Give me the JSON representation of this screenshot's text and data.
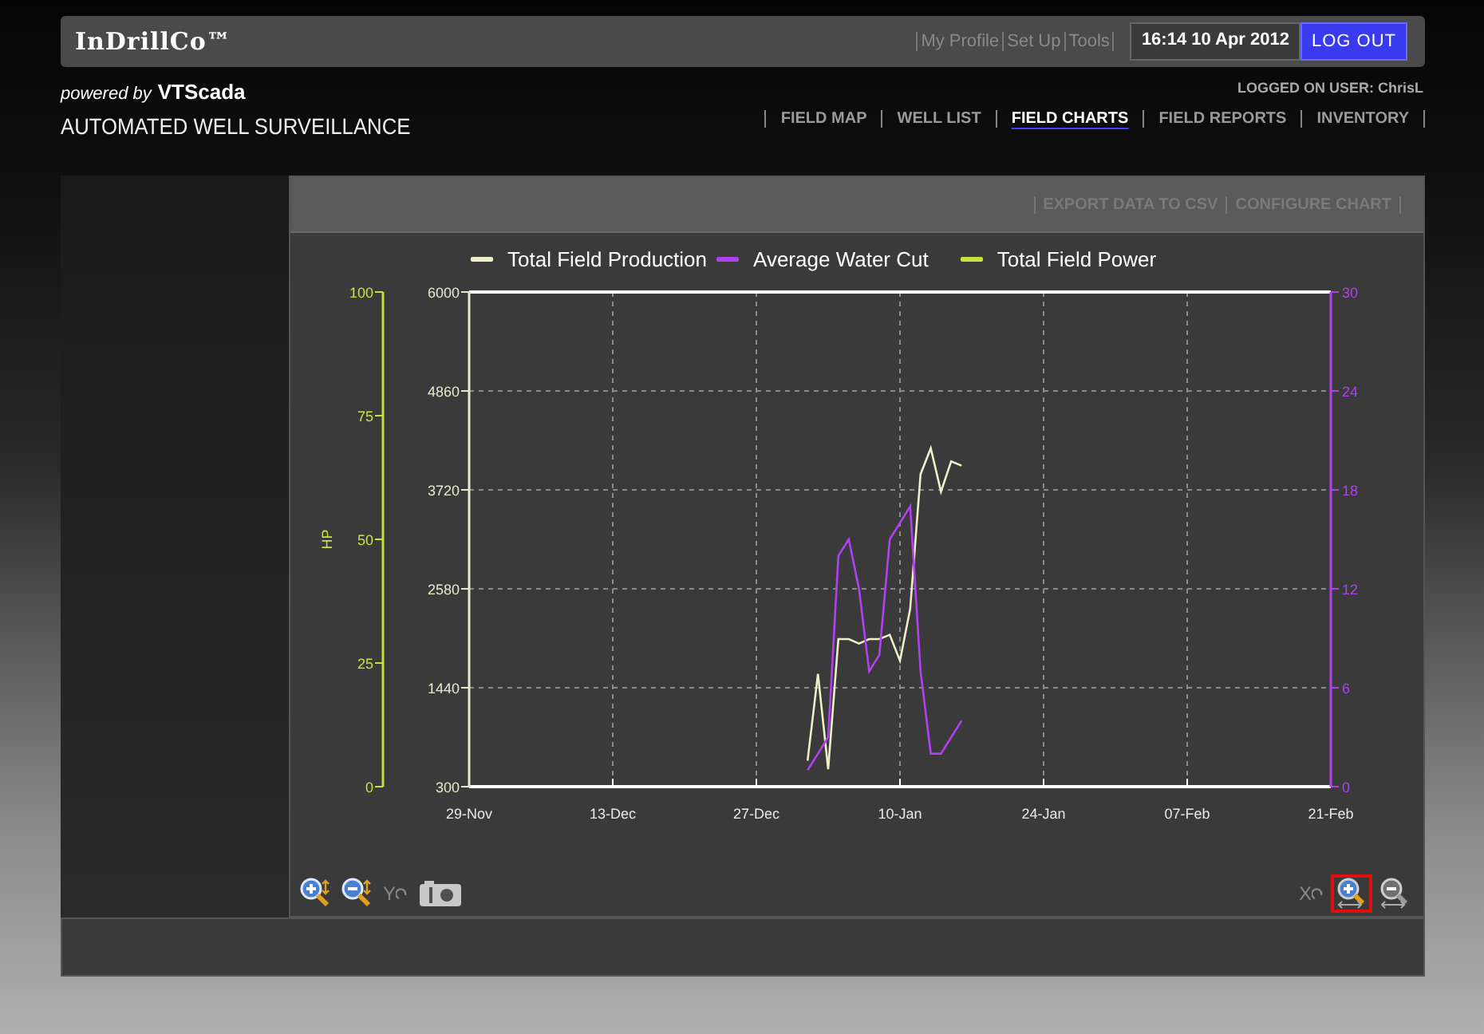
{
  "header": {
    "logo": "InDrillCo™",
    "links": [
      "My Profile",
      "Set Up",
      "Tools"
    ],
    "clock": "16:14 10 Apr 2012",
    "logout": "LOG OUT"
  },
  "brand": {
    "powered_by": "powered by",
    "vendor": "VTScada",
    "subtitle": "AUTOMATED WELL SURVEILLANCE",
    "user": "LOGGED ON USER: ChrisL"
  },
  "nav": [
    {
      "label": "FIELD MAP",
      "selected": false
    },
    {
      "label": "WELL LIST",
      "selected": false
    },
    {
      "label": "FIELD CHARTS",
      "selected": true
    },
    {
      "label": "FIELD REPORTS",
      "selected": false
    },
    {
      "label": "INVENTORY",
      "selected": false
    }
  ],
  "chart_panel": {
    "actions": [
      "EXPORT DATA TO CSV",
      "CONFIGURE CHART"
    ],
    "power_axis": {
      "name": "Total Field Power",
      "color": "#c8e040",
      "label": "HP",
      "ticks": [
        "100",
        "75",
        "50",
        "25",
        "0"
      ]
    },
    "chart_data": {
      "type": "line",
      "categories": [
        "29-Nov",
        null,
        null,
        null,
        null,
        null,
        null,
        null,
        null,
        null,
        null,
        null,
        null,
        null,
        "13-Dec",
        null,
        null,
        null,
        null,
        null,
        null,
        null,
        null,
        null,
        null,
        null,
        null,
        null,
        "27-Dec",
        null,
        null,
        null,
        null,
        null,
        null,
        null,
        null,
        null,
        null,
        null,
        null,
        null,
        "10-Jan",
        null,
        null,
        null,
        null,
        null,
        null,
        null,
        null,
        null,
        null,
        null,
        null,
        null,
        "24-Jan",
        null,
        null,
        null,
        null,
        null,
        null,
        null,
        null,
        null,
        null,
        null,
        null,
        null,
        "07-Feb",
        null,
        null,
        null,
        null,
        null,
        null,
        null,
        null,
        null,
        null,
        null,
        null,
        null,
        "21-Feb"
      ],
      "series": [
        {
          "name": "Total Field Production",
          "color": "#f0f0c8",
          "values": [
            null,
            null,
            null,
            null,
            null,
            null,
            null,
            null,
            null,
            null,
            null,
            null,
            null,
            null,
            null,
            null,
            null,
            null,
            null,
            null,
            null,
            null,
            null,
            null,
            null,
            null,
            null,
            null,
            null,
            null,
            null,
            null,
            null,
            600,
            1600,
            500,
            2000,
            2000,
            1950,
            2000,
            2000,
            2050,
            1750,
            2350,
            3900,
            4200,
            3700,
            4050,
            4000,
            null,
            null,
            null,
            null,
            null,
            null,
            null,
            null,
            null,
            null,
            null,
            null,
            null,
            null,
            null,
            null,
            null,
            null,
            null,
            null,
            null,
            null,
            null,
            null,
            null,
            null,
            null,
            null,
            null,
            null,
            null,
            null,
            null,
            null,
            null,
            null
          ]
        }
      ],
      "ylim": [
        300,
        6000
      ],
      "grid": true,
      "yticks": [
        300,
        1440,
        2580,
        3720,
        4860,
        6000
      ]
    },
    "water_cut": {
      "chart_data": {
        "type": "line",
        "series": [
          {
            "name": "Average Water Cut",
            "color": "#b040f0",
            "values": [
              null,
              null,
              null,
              null,
              null,
              null,
              null,
              null,
              null,
              null,
              null,
              null,
              null,
              null,
              null,
              null,
              null,
              null,
              null,
              null,
              null,
              null,
              null,
              null,
              null,
              null,
              null,
              null,
              null,
              null,
              null,
              null,
              null,
              1,
              2,
              3,
              14,
              15,
              12,
              7,
              8,
              15,
              16,
              17,
              7,
              2,
              2,
              3,
              4,
              null,
              null,
              null,
              null,
              null,
              null,
              null,
              null,
              null,
              null,
              null,
              null,
              null,
              null,
              null,
              null,
              null,
              null,
              null,
              null,
              null,
              null,
              null,
              null,
              null,
              null,
              null,
              null,
              null,
              null,
              null,
              null,
              null,
              null,
              null,
              null
            ]
          }
        ],
        "ylim": [
          0,
          30
        ],
        "yticks": [
          30,
          24,
          18,
          12,
          6,
          0
        ]
      }
    },
    "tools_left": [
      {
        "kind": "zoom-in"
      },
      {
        "kind": "zoom-out"
      },
      {
        "kind": "reset",
        "label": "Y"
      },
      {
        "kind": "camera"
      }
    ],
    "tools_right": [
      {
        "kind": "reset",
        "label": "X",
        "selected": false
      },
      {
        "kind": "zoom-in",
        "selected": true
      },
      {
        "kind": "zoom-out",
        "selected": false
      }
    ]
  }
}
